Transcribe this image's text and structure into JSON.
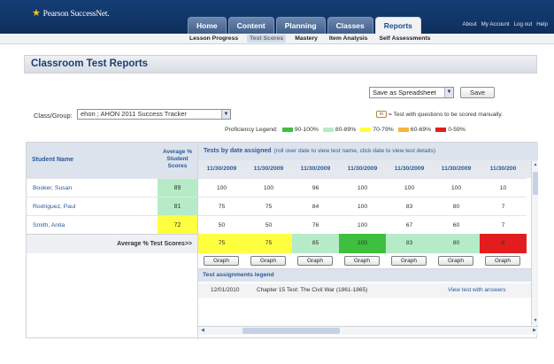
{
  "brand": {
    "name": "Pearson SuccessNet",
    "trademark": "."
  },
  "nav": {
    "tabs": [
      "Home",
      "Content",
      "Planning",
      "Classes",
      "Reports"
    ],
    "active_index": 4,
    "utility_links": [
      "About",
      "My Account",
      "Log out",
      "Help"
    ]
  },
  "subnav": {
    "items": [
      "Lesson Progress",
      "Test Scores",
      "Mastery",
      "Item Analysis",
      "Self Assessments"
    ],
    "active_index": 1
  },
  "page": {
    "title": "Classroom Test Reports"
  },
  "export": {
    "selected": "Save as Spreadsheet",
    "save_label": "Save"
  },
  "class_group": {
    "label": "Class/Group:",
    "selected": "ehon ; AHON 2011 Success Tracker"
  },
  "manual_note": {
    "badge": "m",
    "text": "= Test with questions to be scored manually."
  },
  "proficiency_legend": {
    "title": "Proficiency Legend:",
    "items": [
      {
        "label": "90-100%",
        "color": "#3fbf3f"
      },
      {
        "label": "80-89%",
        "color": "#b5ecc7"
      },
      {
        "label": "70-79%",
        "color": "#ffff3f"
      },
      {
        "label": "60-69%",
        "color": "#f5b63a"
      },
      {
        "label": "0-59%",
        "color": "#e31d1d"
      }
    ]
  },
  "report": {
    "student_header": "Student Name",
    "average_header": "Average % Student Scores",
    "tests_header": "Tests by date assigned",
    "tests_hint": "(roll over date to view test name, click date to view test details)",
    "average_row_label": "Average % Test Scores>>",
    "graph_label": "Graph",
    "dates": [
      "11/30/2009",
      "11/30/2009",
      "11/30/2009",
      "11/30/2009",
      "11/30/2009",
      "11/30/2009",
      "11/30/200"
    ],
    "students": [
      {
        "name": "Booker, Susan",
        "average": "89",
        "scores": [
          "100",
          "100",
          "96",
          "100",
          "100",
          "100",
          "10"
        ]
      },
      {
        "name": "Rodriguez, Paul",
        "average": "81",
        "scores": [
          "75",
          "75",
          "84",
          "100",
          "83",
          "80",
          "7"
        ]
      },
      {
        "name": "Smith, Anita",
        "average": "72",
        "scores": [
          "50",
          "50",
          "76",
          "100",
          "67",
          "60",
          "7"
        ]
      }
    ],
    "test_averages": [
      "75",
      "75",
      "85",
      "100",
      "83",
      "80",
      "8"
    ]
  },
  "assignments_legend": {
    "title": "Test assignments legend",
    "rows": [
      {
        "date": "12/01/2010",
        "name": "Chapter 15 Test: The Civil War (1861-1865)",
        "action": "View test with answers"
      }
    ]
  }
}
